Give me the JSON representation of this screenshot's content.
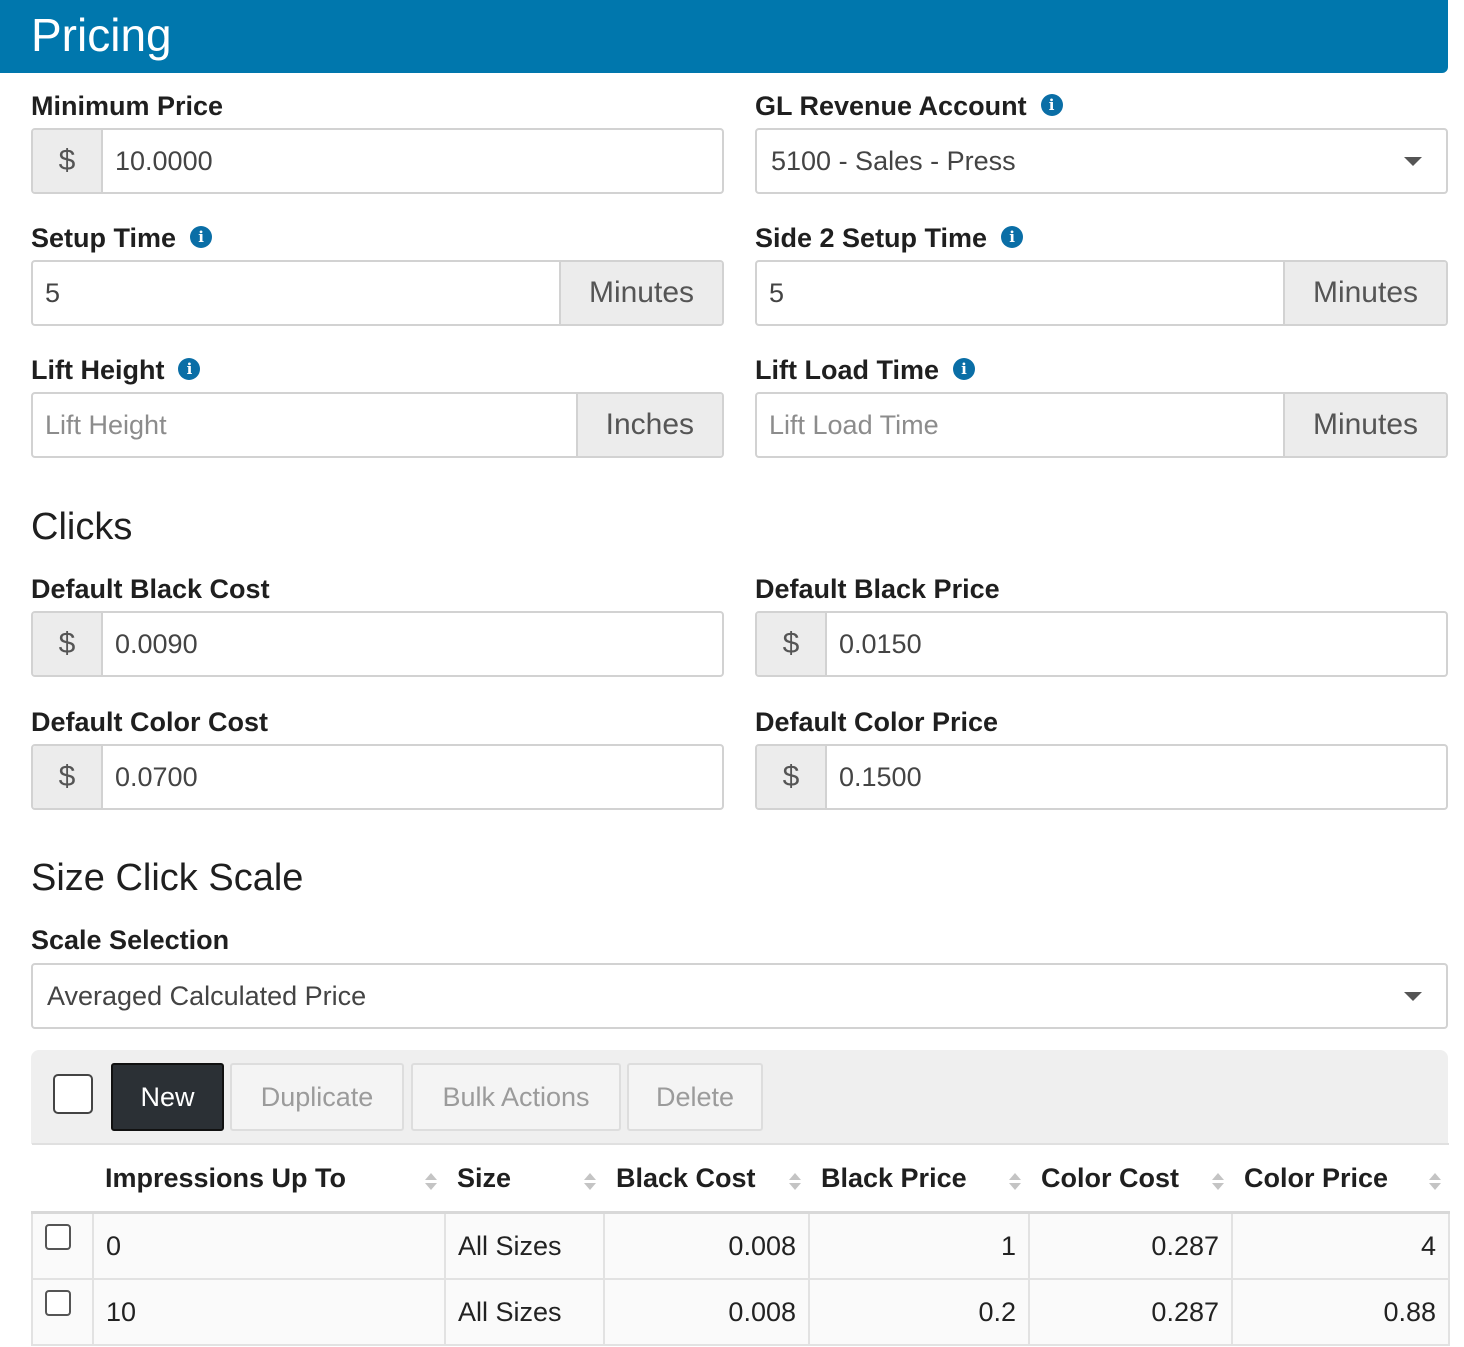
{
  "header": {
    "title": "Pricing"
  },
  "pricing": {
    "minimum_price": {
      "label": "Minimum Price",
      "prefix": "$",
      "value": "10.0000"
    },
    "gl_revenue_account": {
      "label": "GL Revenue Account",
      "value": "5100 - Sales - Press"
    },
    "setup_time": {
      "label": "Setup Time",
      "value": "5",
      "suffix": "Minutes"
    },
    "side2_setup_time": {
      "label": "Side 2 Setup Time",
      "value": "5",
      "suffix": "Minutes"
    },
    "lift_height": {
      "label": "Lift Height",
      "placeholder": "Lift Height",
      "suffix": "Inches"
    },
    "lift_load_time": {
      "label": "Lift Load Time",
      "placeholder": "Lift Load Time",
      "suffix": "Minutes"
    }
  },
  "clicks": {
    "title": "Clicks",
    "default_black_cost": {
      "label": "Default Black Cost",
      "prefix": "$",
      "value": "0.0090"
    },
    "default_black_price": {
      "label": "Default Black Price",
      "prefix": "$",
      "value": "0.0150"
    },
    "default_color_cost": {
      "label": "Default Color Cost",
      "prefix": "$",
      "value": "0.0700"
    },
    "default_color_price": {
      "label": "Default Color Price",
      "prefix": "$",
      "value": "0.1500"
    }
  },
  "size_click_scale": {
    "title": "Size Click Scale",
    "scale_selection": {
      "label": "Scale Selection",
      "value": "Averaged Calculated Price"
    },
    "toolbar": {
      "new": "New",
      "duplicate": "Duplicate",
      "bulk_actions": "Bulk Actions",
      "delete": "Delete"
    },
    "columns": [
      "Impressions Up To",
      "Size",
      "Black Cost",
      "Black Price",
      "Color Cost",
      "Color Price"
    ],
    "rows": [
      {
        "impressions": "0",
        "size": "All Sizes",
        "black_cost": "0.008",
        "black_price": "1",
        "color_cost": "0.287",
        "color_price": "4"
      },
      {
        "impressions": "10",
        "size": "All Sizes",
        "black_cost": "0.008",
        "black_price": "0.2",
        "color_cost": "0.287",
        "color_price": "0.88"
      }
    ]
  },
  "colors": {
    "header_bg": "#0077ad",
    "info_icon": "#0a6ea6",
    "primary_button": "#2b3035"
  },
  "icons": {
    "info": "info-circle-icon",
    "dropdown": "caret-down-icon",
    "sort": "sort-icon"
  }
}
